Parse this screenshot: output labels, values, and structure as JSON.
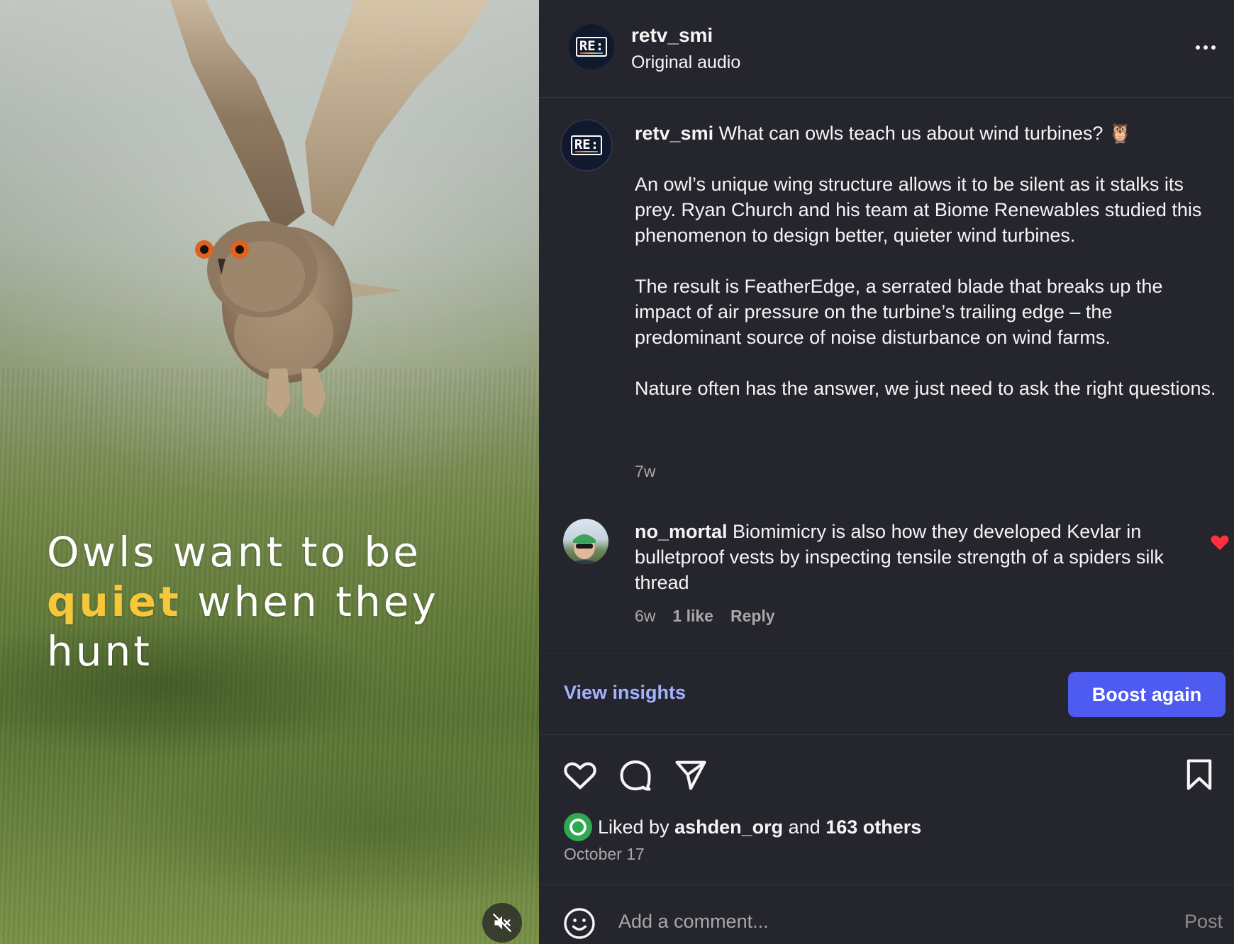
{
  "media": {
    "overlay_line1": "Owls want to be",
    "overlay_highlight": "quiet",
    "overlay_line2_rest": " when they",
    "overlay_line3": "hunt",
    "highlight_color": "#f6c63b",
    "mute_icon": "speaker-muted-icon"
  },
  "header": {
    "avatar_logo": "RE:",
    "username": "retv_smi",
    "audio": "Original audio",
    "more_icon": "more-horizontal-icon"
  },
  "caption": {
    "username": "retv_smi",
    "line1": "What can owls teach us about wind turbines? 🦉",
    "paragraph2": "An owl’s unique wing structure allows it to be silent as it stalks its prey. Ryan Church and his team at Biome Renewables studied this phenomenon to design better, quieter wind turbines.",
    "paragraph3": "The result is FeatherEdge, a serrated blade that breaks up the impact of air pressure on the turbine’s trailing edge – the predominant source of noise disturbance on wind farms.",
    "paragraph4": "Nature often has the answer, we just need to ask the right questions.",
    "time": "7w"
  },
  "comment": {
    "username": "no_mortal",
    "text": "Biomimicry is also how they developed Kevlar in bulletproof vests by inspecting tensile strength of a spiders silk thread",
    "time": "6w",
    "likes": "1 like",
    "reply": "Reply",
    "heart_color": "#ff3040"
  },
  "insights": {
    "view_insights": "View insights",
    "boost_again": "Boost again",
    "accent": "#4e5bf1",
    "link_color": "#a4b3ff"
  },
  "actions": {
    "icons": [
      "heart-icon",
      "comment-icon",
      "share-icon",
      "bookmark-icon"
    ],
    "liked_prefix": "Liked by ",
    "liked_user": "ashden_org",
    "liked_and": " and ",
    "liked_others": "163 others",
    "date": "October 17"
  },
  "comment_bar": {
    "placeholder": "Add a comment...",
    "post": "Post",
    "emoji_icon": "emoji-icon"
  },
  "colors": {
    "panel_bg": "#25262d",
    "muted_text": "#a8a8a8"
  }
}
